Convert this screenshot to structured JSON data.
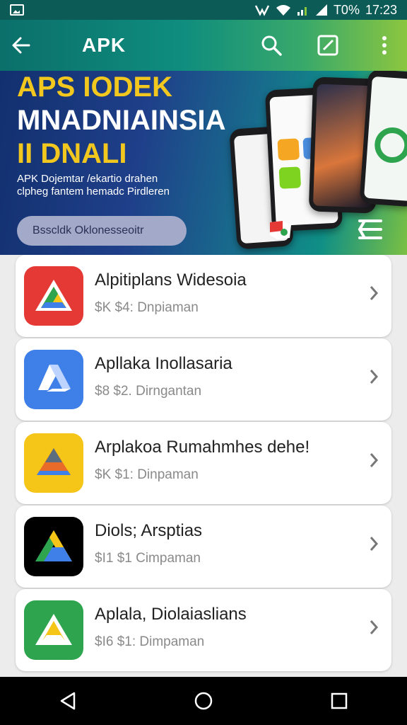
{
  "status_bar": {
    "battery": "T0%",
    "time": "17:23"
  },
  "app_bar": {
    "title": "APK"
  },
  "banner": {
    "line1": "APS IODEK",
    "line2": "MNADNIAINSIA",
    "line3": "II DNALI",
    "subtitle_line1": "APK Dojemtar /ekartio drahen",
    "subtitle_line2": "clpheg fantem hemadc Pirdleren",
    "search_pill": "Bsscldk Oklonesseoitr"
  },
  "apps": [
    {
      "name": "Alpitiplans Widesoia",
      "meta": "$K $4: Dnpiaman",
      "icon": "red-drive-icon",
      "bg": "#e53935"
    },
    {
      "name": "Apllaka Inollasaria",
      "meta": "$8 $2. Dirngantan",
      "icon": "blue-drive-icon",
      "bg": "#3f7fe8"
    },
    {
      "name": "Arplakoa Rumahmhes dehe!",
      "meta": "$K $1: Dinpaman",
      "icon": "yellow-drive-icon",
      "bg": "#f5c518"
    },
    {
      "name": "Diols; Arsptias",
      "meta": "$I1 $1 Cimpaman",
      "icon": "black-drive-icon",
      "bg": "#000000"
    },
    {
      "name": "Aplala, Diolaiaslians",
      "meta": "$I6 $1: Dimpaman",
      "icon": "green-drive-icon",
      "bg": "#2ea44f"
    }
  ]
}
